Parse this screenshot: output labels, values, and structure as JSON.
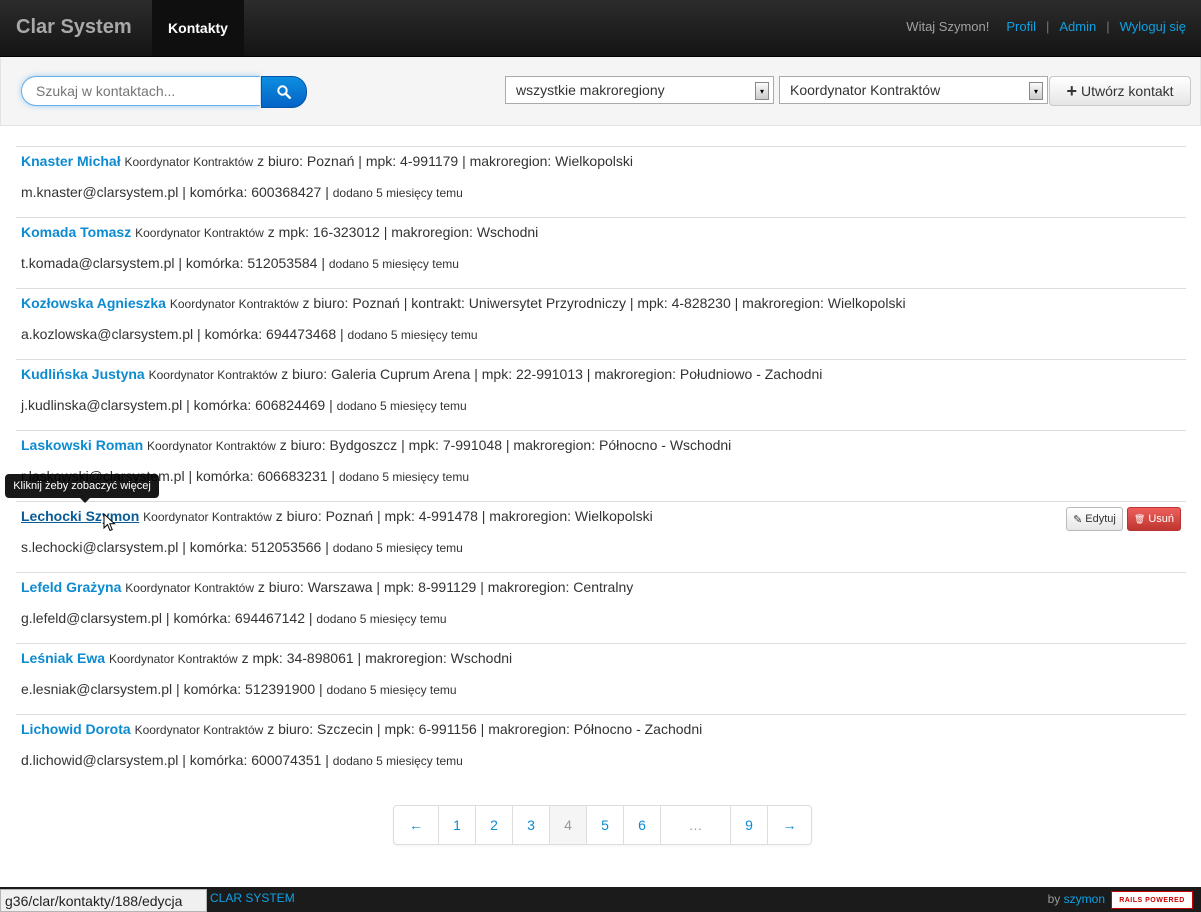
{
  "navbar": {
    "brand": "Clar System",
    "active_tab": "Kontakty",
    "greeting": "Witaj Szymon!",
    "links": [
      "Profil",
      "Admin",
      "Wyloguj się"
    ],
    "separator": "|"
  },
  "toolbar": {
    "search_placeholder": "Szukaj w kontaktach...",
    "region_select": "wszystkie makroregiony",
    "role_select": "Koordynator Kontraktów",
    "create_label": "Utwórz kontakt"
  },
  "contacts": [
    {
      "name": "Knaster Michał",
      "role": "Koordynator Kontraktów",
      "details": "z biuro: Poznań | mpk: 4-991179 | makroregion: Wielkopolski",
      "contact": "m.knaster@clarsystem.pl | komórka: 600368427 |",
      "added": "dodano 5 miesięcy temu"
    },
    {
      "name": "Komada Tomasz",
      "role": "Koordynator Kontraktów",
      "details": "z mpk: 16-323012 | makroregion: Wschodni",
      "contact": "t.komada@clarsystem.pl | komórka: 512053584 |",
      "added": "dodano 5 miesięcy temu"
    },
    {
      "name": "Kozłowska Agnieszka",
      "role": "Koordynator Kontraktów",
      "details": "z biuro: Poznań | kontrakt: Uniwersytet Przyrodniczy | mpk: 4-828230 | makroregion: Wielkopolski",
      "contact": "a.kozlowska@clarsystem.pl | komórka: 694473468 |",
      "added": "dodano 5 miesięcy temu"
    },
    {
      "name": "Kudlińska Justyna",
      "role": "Koordynator Kontraktów",
      "details": "z biuro: Galeria Cuprum Arena | mpk: 22-991013 | makroregion: Południowo - Zachodni",
      "contact": "j.kudlinska@clarsystem.pl | komórka: 606824469 |",
      "added": "dodano 5 miesięcy temu"
    },
    {
      "name": "Laskowski Roman",
      "role": "Koordynator Kontraktów",
      "details": "z biuro: Bydgoszcz | mpk: 7-991048 | makroregion: Północno - Wschodni",
      "contact": "r.laskowski@clarsystem.pl | komórka: 606683231 |",
      "added": "dodano 5 miesięcy temu"
    },
    {
      "name": "Lechocki Szymon",
      "role": "Koordynator Kontraktów",
      "details": "z biuro: Poznań | mpk: 4-991478 | makroregion: Wielkopolski",
      "contact": "s.lechocki@clarsystem.pl | komórka: 512053566 |",
      "added": "dodano 5 miesięcy temu"
    },
    {
      "name": "Lefeld Grażyna",
      "role": "Koordynator Kontraktów",
      "details": "z biuro: Warszawa | mpk: 8-991129 | makroregion: Centralny",
      "contact": "g.lefeld@clarsystem.pl | komórka: 694467142 |",
      "added": "dodano 5 miesięcy temu"
    },
    {
      "name": "Leśniak Ewa",
      "role": "Koordynator Kontraktów",
      "details": "z mpk: 34-898061 | makroregion: Wschodni",
      "contact": "e.lesniak@clarsystem.pl | komórka: 512391900 |",
      "added": "dodano 5 miesięcy temu"
    },
    {
      "name": "Lichowid Dorota",
      "role": "Koordynator Kontraktów",
      "details": "z biuro: Szczecin | mpk: 6-991156 | makroregion: Północno - Zachodni",
      "contact": "d.lichowid@clarsystem.pl | komórka: 600074351 |",
      "added": "dodano 5 miesięcy temu"
    }
  ],
  "row_actions": {
    "edit": "Edytuj",
    "delete": "Usuń"
  },
  "tooltip": "Kliknij żeby zobaczyć więcej",
  "pagination": {
    "pages": [
      "←",
      "1",
      "2",
      "3",
      "4",
      "5",
      "6",
      "…",
      "9",
      "→"
    ],
    "current": "4"
  },
  "footer": {
    "system": "CLAR SYSTEM",
    "by": "by",
    "author": "szymon",
    "badge": "RAILS POWERED"
  },
  "statusbar": "g36/clar/kontakty/188/edycja"
}
